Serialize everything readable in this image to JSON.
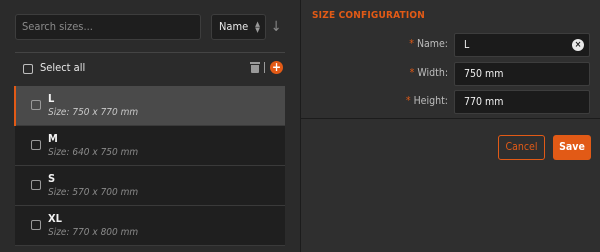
{
  "search": {
    "placeholder": "Search sizes..."
  },
  "sort": {
    "selected": "Name",
    "caret_up": "▲",
    "caret_down": "▼",
    "direction_icon": "↓"
  },
  "toolbar": {
    "select_all_label": "Select all",
    "add_icon": "+"
  },
  "items": [
    {
      "name": "L",
      "size": "Size: 750 x 770 mm",
      "active": true
    },
    {
      "name": "M",
      "size": "Size: 640 x 750 mm",
      "active": false
    },
    {
      "name": "S",
      "size": "Size: 570 x 700 mm",
      "active": false
    },
    {
      "name": "XL",
      "size": "Size: 770 x 800 mm",
      "active": false
    }
  ],
  "config": {
    "title": "SIZE CONFIGURATION",
    "fields": [
      {
        "required_mark": "*",
        "label": "Name:",
        "value": "L",
        "clear_icon": "×"
      },
      {
        "required_mark": "*",
        "label": "Width:",
        "value": "750 mm"
      },
      {
        "required_mark": "*",
        "label": "Height:",
        "value": "770 mm"
      }
    ],
    "cancel_label": "Cancel",
    "save_label": "Save"
  },
  "colors": {
    "accent": "#e25a16",
    "panel": "#2b2b2b",
    "input_bg": "#1b1b1b"
  }
}
